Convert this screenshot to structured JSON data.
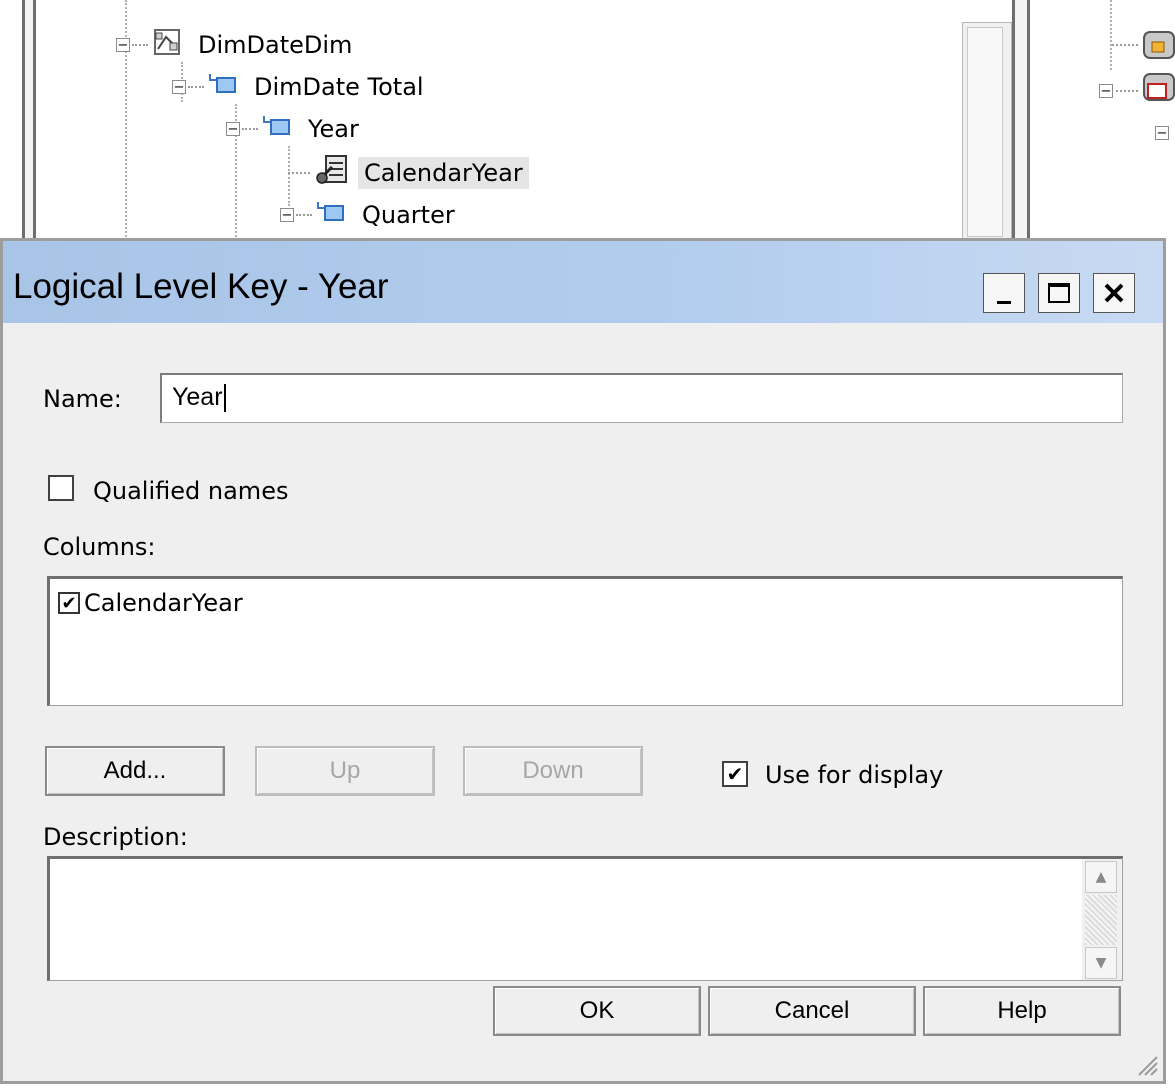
{
  "background_tree": {
    "items": [
      {
        "label": "DimDateDim",
        "icon": "hierarchy-icon"
      },
      {
        "label": "DimDate Total",
        "icon": "level-icon"
      },
      {
        "label": "Year",
        "icon": "level-icon"
      },
      {
        "label": "CalendarYear",
        "icon": "key-column-icon",
        "selected": true
      },
      {
        "label": "Quarter",
        "icon": "level-icon"
      }
    ]
  },
  "dialog": {
    "title": "Logical Level Key - Year",
    "controls": {
      "minimize": "_",
      "maximize": "□",
      "close": "✕"
    },
    "name_label": "Name:",
    "name_value": "Year",
    "qualified_names_label": "Qualified names",
    "qualified_names_checked": false,
    "columns_label": "Columns:",
    "columns": [
      {
        "label": "CalendarYear",
        "checked": true
      }
    ],
    "buttons": {
      "add": "Add...",
      "up": "Up",
      "down": "Down"
    },
    "use_for_display_label": "Use for display",
    "use_for_display_checked": true,
    "description_label": "Description:",
    "description_value": "",
    "footer": {
      "ok": "OK",
      "cancel": "Cancel",
      "help": "Help"
    }
  }
}
